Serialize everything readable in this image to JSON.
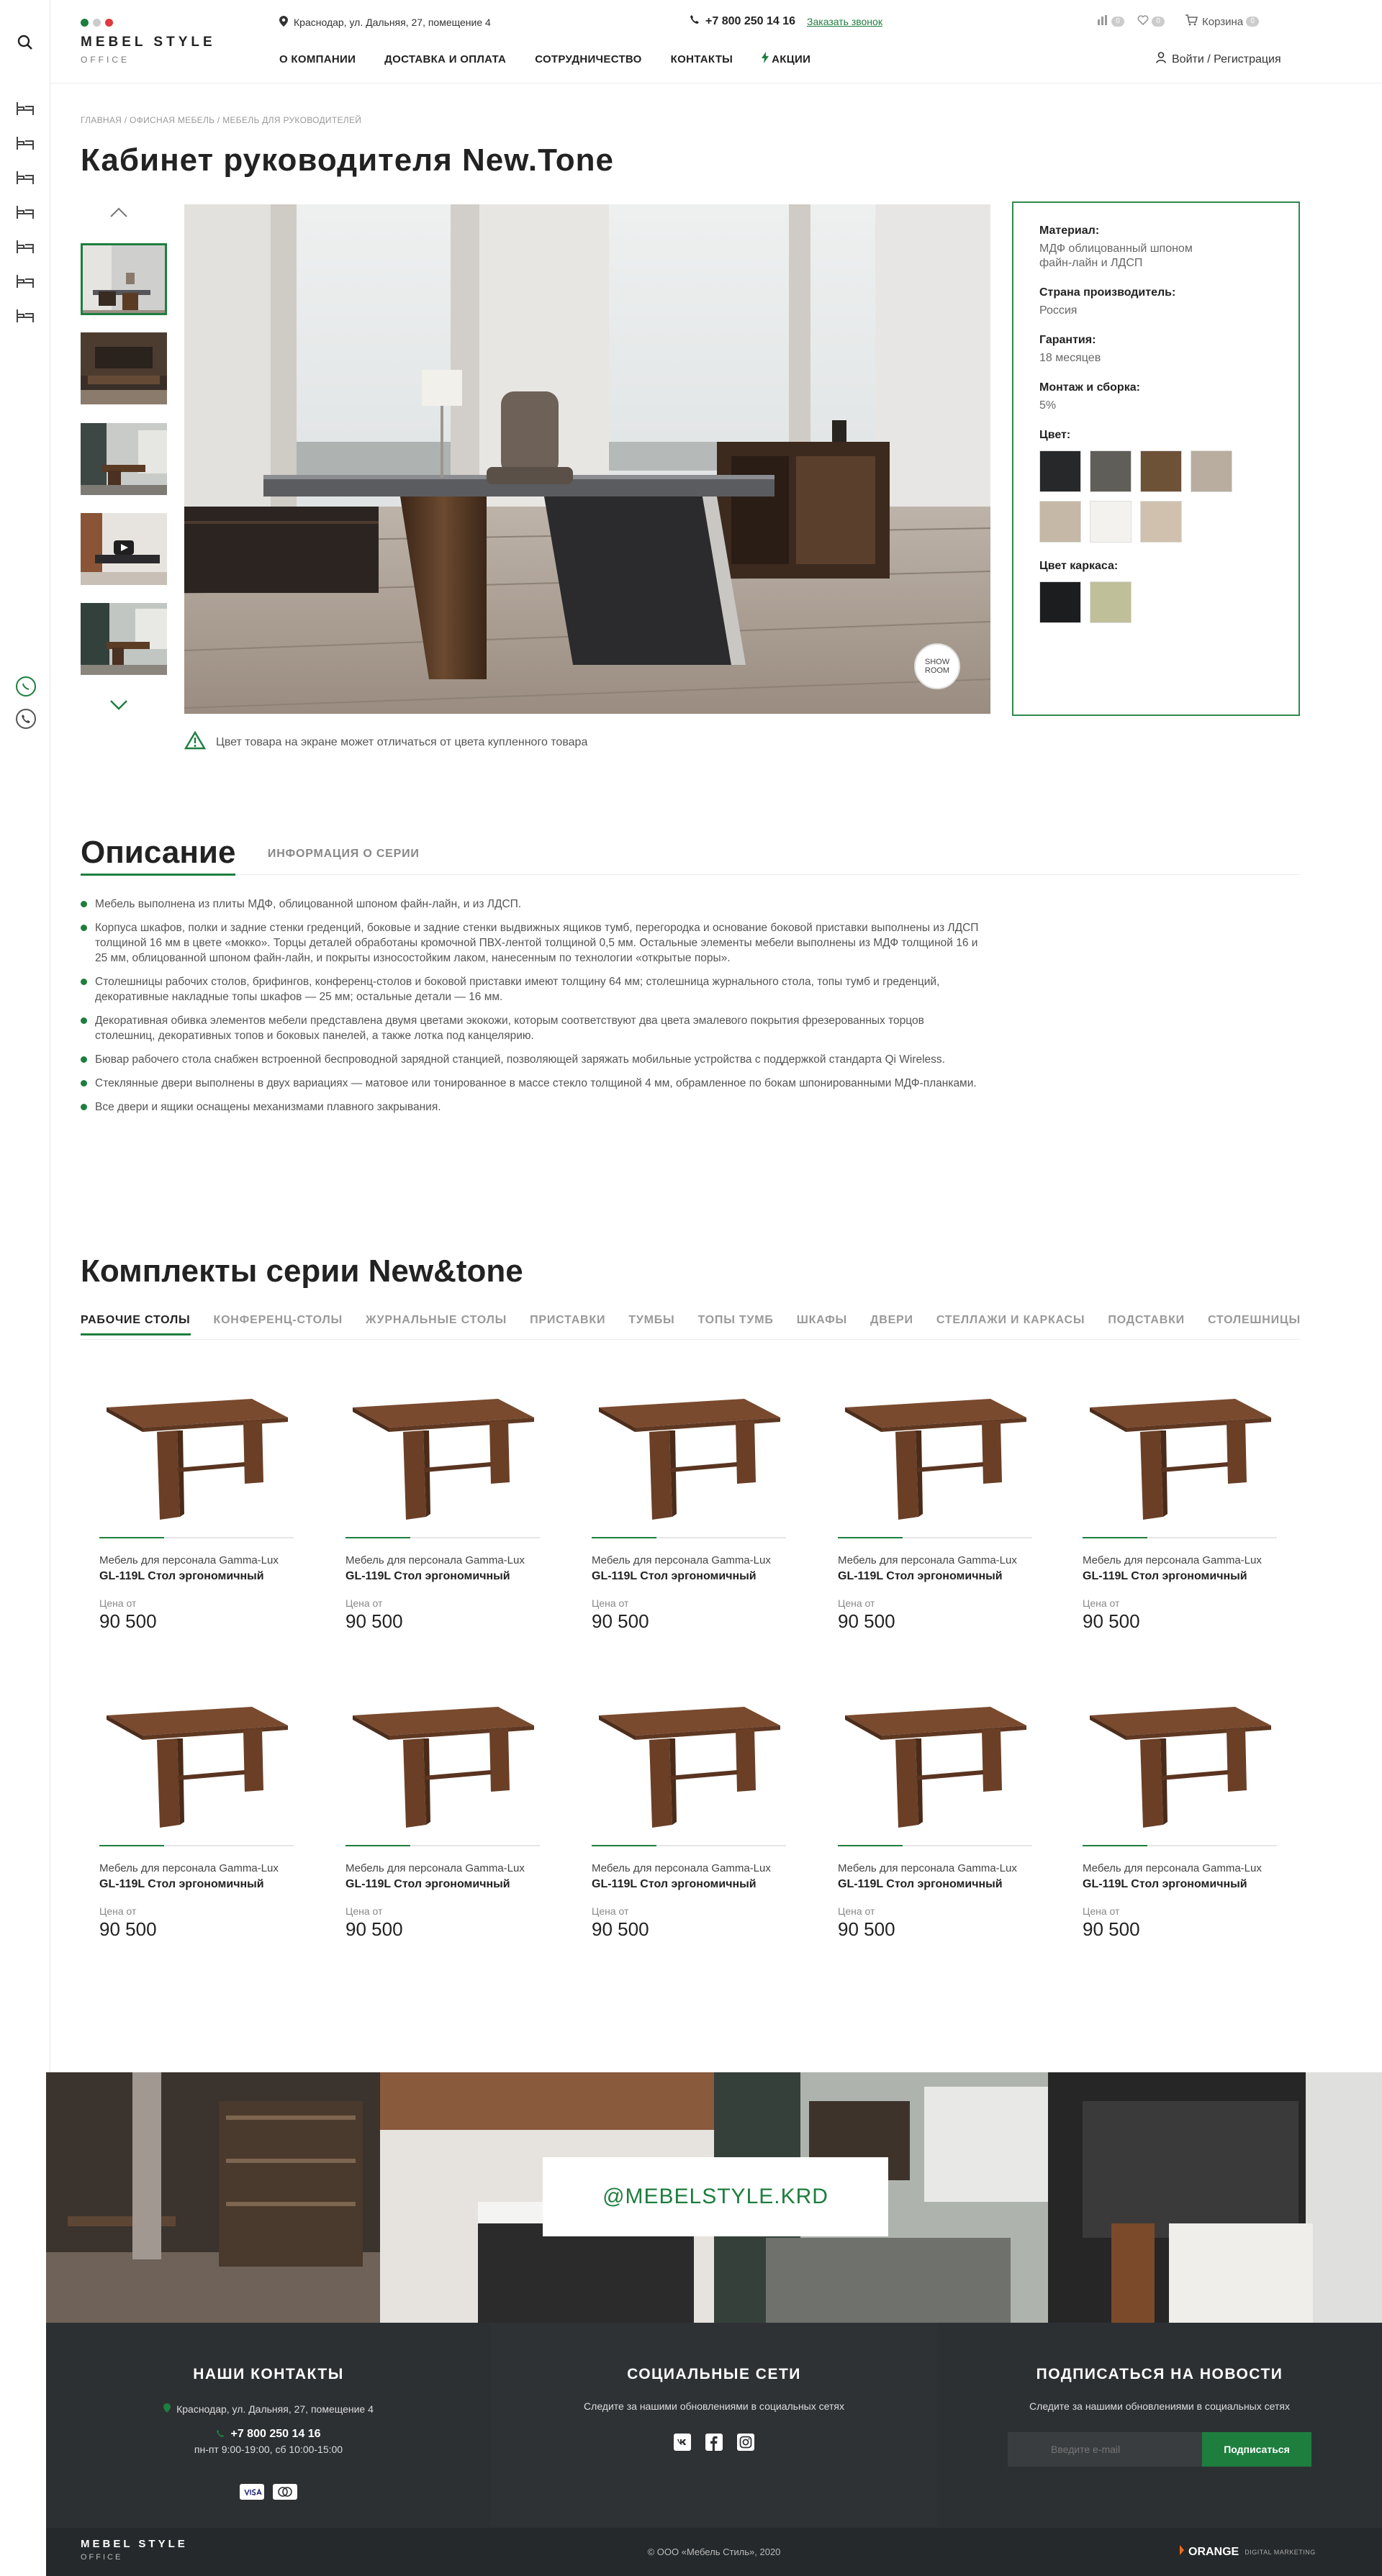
{
  "header": {
    "logo_main": "MEBEL STYLE",
    "logo_sub": "OFFICE",
    "address": "Краснодар, ул. Дальняя, 27, помещение 4",
    "phone": "+7 800 250 14 16",
    "callback": "Заказать звонок",
    "compare_count": "0",
    "wishlist_count": "0",
    "cart_label": "Корзина",
    "cart_count": "0",
    "nav": [
      "О КОМПАНИИ",
      "ДОСТАВКА И ОПЛАТА",
      "СОТРУДНИЧЕСТВО",
      "КОНТАКТЫ",
      "АКЦИИ"
    ],
    "login": "Войти / Регистрация",
    "dot_colors": [
      "#1e7e3e",
      "#cccccc",
      "#e0393e"
    ]
  },
  "breadcrumb": "ГЛАВНАЯ / ОФИСНАЯ МЕБЕЛЬ / МЕБЕЛЬ ДЛЯ РУКОВОДИТЕЛЕЙ",
  "product": {
    "title": "Кабинет руководителя New.Tone",
    "show_room": [
      "SHOW",
      "ROOM"
    ],
    "notice": "Цвет товара на экране может отличаться от цвета купленного товара"
  },
  "specs": {
    "material_label": "Материал:",
    "material_value": "МДФ облицованный шпоном файн-лайн и ЛДСП",
    "country_label": "Страна производитель:",
    "country_value": "Россия",
    "warranty_label": "Гарантия:",
    "warranty_value": "18 месяцев",
    "assembly_label": "Монтаж и сборка:",
    "assembly_value": "5%",
    "color_label": "Цвет:",
    "colors": [
      "#26282a",
      "#5f5e58",
      "#6e5238",
      "#b8ad9f",
      "#c5b8a6",
      "#f4f2ef",
      "#cfc1ae"
    ],
    "frame_label": "Цвет каркаса:",
    "frame_colors": [
      "#1c1d1f",
      "#bfc09a"
    ]
  },
  "description": {
    "title": "Описание",
    "tab2": "ИНФОРМАЦИЯ О СЕРИИ",
    "items": [
      "Мебель выполнена из плиты МДФ, облицованной шпоном файн-лайн, и из ЛДСП.",
      "Корпуса шкафов, полки и задние стенки греденций, боковые и задние стенки выдвижных ящиков тумб, перегородка и основание боковой приставки выполнены из ЛДСП толщиной 16 мм в цвете «мокко». Торцы деталей обработаны кромочной ПВХ-лентой толщиной 0,5 мм. Остальные элементы мебели выполнены из МДФ толщиной 16 и 25 мм, облицованной шпоном файн-лайн, и покрыты износостойким лаком, нанесенным по технологии «открытые поры».",
      "Столешницы рабочих столов, брифингов, конференц-столов и боковой приставки имеют толщину 64 мм; столешница журнального стола, топы тумб и греденций, декоративные накладные топы шкафов — 25 мм; остальные детали — 16 мм.",
      "Декоративная обивка элементов мебели представлена двумя цветами экокожи, которым соответствуют два цвета эмалевого покрытия фрезерованных торцов столешниц, декоративных топов и боковых панелей, а также лотка под канцелярию.",
      "Бювар рабочего стола снабжен встроенной беспроводной зарядной станцией, позволяющей заряжать мобильные устройства с поддержкой стандарта Qi Wireless.",
      "Стеклянные двери выполнены в двух вариациях — матовое или тонированное в массе стекло толщиной 4 мм, обрамленное по бокам шпонированными МДФ-планками.",
      "Все двери и ящики оснащены механизмами плавного закрывания."
    ]
  },
  "series": {
    "title": "Комплекты серии New&tone",
    "tabs": [
      "РАБОЧИЕ СТОЛЫ",
      "КОНФЕРЕНЦ-СТОЛЫ",
      "ЖУРНАЛЬНЫЕ СТОЛЫ",
      "ПРИСТАВКИ",
      "ТУМБЫ",
      "ТОПЫ ТУМБ",
      "ШКАФЫ",
      "ДВЕРИ",
      "СТЕЛЛАЖИ И КАРКАСЫ",
      "ПОДСТАВКИ",
      "СТОЛЕШНИЦЫ"
    ],
    "products": [
      {
        "category": "Мебель для персонала Gamma-Lux",
        "name": "GL-119L Стол эргономичный",
        "price_from": "Цена от",
        "price": "90 500"
      },
      {
        "category": "Мебель для персонала Gamma-Lux",
        "name": "GL-119L Стол эргономичный",
        "price_from": "Цена от",
        "price": "90 500"
      },
      {
        "category": "Мебель для персонала Gamma-Lux",
        "name": "GL-119L Стол эргономичный",
        "price_from": "Цена от",
        "price": "90 500"
      },
      {
        "category": "Мебель для персонала Gamma-Lux",
        "name": "GL-119L Стол эргономичный",
        "price_from": "Цена от",
        "price": "90 500"
      },
      {
        "category": "Мебель для персонала Gamma-Lux",
        "name": "GL-119L Стол эргономичный",
        "price_from": "Цена от",
        "price": "90 500"
      },
      {
        "category": "Мебель для персонала Gamma-Lux",
        "name": "GL-119L Стол эргономичный",
        "price_from": "Цена от",
        "price": "90 500"
      },
      {
        "category": "Мебель для персонала Gamma-Lux",
        "name": "GL-119L Стол эргономичный",
        "price_from": "Цена от",
        "price": "90 500"
      },
      {
        "category": "Мебель для персонала Gamma-Lux",
        "name": "GL-119L Стол эргономичный",
        "price_from": "Цена от",
        "price": "90 500"
      },
      {
        "category": "Мебель для персонала Gamma-Lux",
        "name": "GL-119L Стол эргономичный",
        "price_from": "Цена от",
        "price": "90 500"
      },
      {
        "category": "Мебель для персонала Gamma-Lux",
        "name": "GL-119L Стол эргономичный",
        "price_from": "Цена от",
        "price": "90 500"
      }
    ]
  },
  "instagram": "@MEBELSTYLE.KRD",
  "footer": {
    "contacts_title": "НАШИ КОНТАКТЫ",
    "address": "Краснодар, ул. Дальняя, 27, помещение 4",
    "phone": "+7 800 250 14 16",
    "hours": "пн-пт 9:00-19:00, сб 10:00-15:00",
    "social_title": "СОЦИАЛЬНЫЕ СЕТИ",
    "social_text": "Следите за нашими обновлениями в социальных сетях",
    "social_icons": [
      "vk-icon",
      "facebook-icon",
      "instagram-icon"
    ],
    "news_title": "ПОДПИСАТЬСЯ НА НОВОСТИ",
    "news_text": "Следите за нашими обновлениями в социальных сетях",
    "email_placeholder": "Введите e-mail",
    "subscribe": "Подписаться",
    "payment_icons": [
      "visa-icon",
      "mastercard-icon"
    ],
    "copyright": "© ООО «Мебель Стиль», 2020",
    "logo_main": "MEBEL STYLE",
    "logo_sub": "OFFICE",
    "dev_logo": "ORANGE",
    "dev_sub": "DIGITAL MARKETING"
  },
  "colors": {
    "accent": "#1e7e3e",
    "footer_bg": "#2d3033",
    "footer_bottom": "#26292b"
  }
}
